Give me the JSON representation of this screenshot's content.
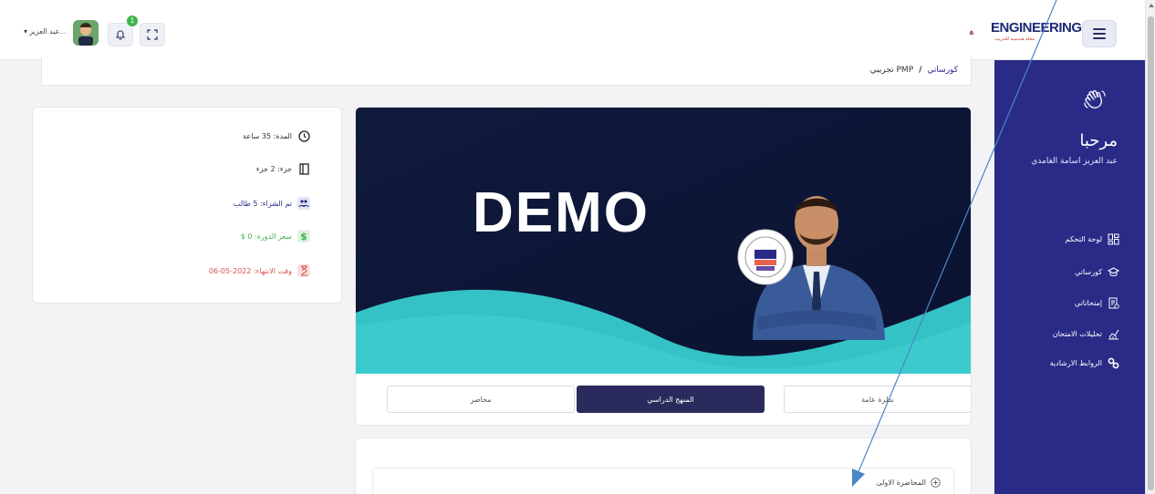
{
  "header": {
    "brand": "ENGINEERING",
    "brand_sub": "مجلة هندسية للتدريب",
    "notification_count": "1",
    "user_menu_label": "عبد العزيز..."
  },
  "sidebar": {
    "welcome": "مرحبا",
    "user_name": "عبد العزيز اسامة الغامدي",
    "items": [
      {
        "label": "لوحة التحكم",
        "icon": "dashboard-icon"
      },
      {
        "label": "كورساتي",
        "icon": "graduation-cap-icon"
      },
      {
        "label": "إمتحاناتي",
        "icon": "exam-icon"
      },
      {
        "label": "تحليلات الامتحان",
        "icon": "analytics-icon"
      },
      {
        "label": "الروابط الارشادية",
        "icon": "link-icon"
      }
    ]
  },
  "breadcrumb": {
    "root": "كورساتي",
    "separator": "/",
    "current": "PMP تجريبي"
  },
  "course_info": {
    "duration": "المدة: 35 ساعة",
    "parts": "جزء: 2 جزء",
    "purchased": "تم الشراء: 5 طالب",
    "price": "سعر الدورة: 0 $",
    "expiry": "وقت الانتهاء: 2022-05-06"
  },
  "banner": {
    "title": "DEMO"
  },
  "tabs": [
    {
      "label": "نظرة عامة",
      "active": false
    },
    {
      "label": "المنهج الدراسي",
      "active": true
    },
    {
      "label": "محاضر",
      "active": false
    }
  ],
  "lectures": [
    {
      "label": "المحاضرة الاولى"
    }
  ],
  "colors": {
    "sidebar": "#2a2b87",
    "active_tab": "#2a2b5c",
    "price": "#3bb54a",
    "expiry": "#d9534f",
    "purchased": "#2a2b87",
    "annotation": "#4a86c8"
  }
}
